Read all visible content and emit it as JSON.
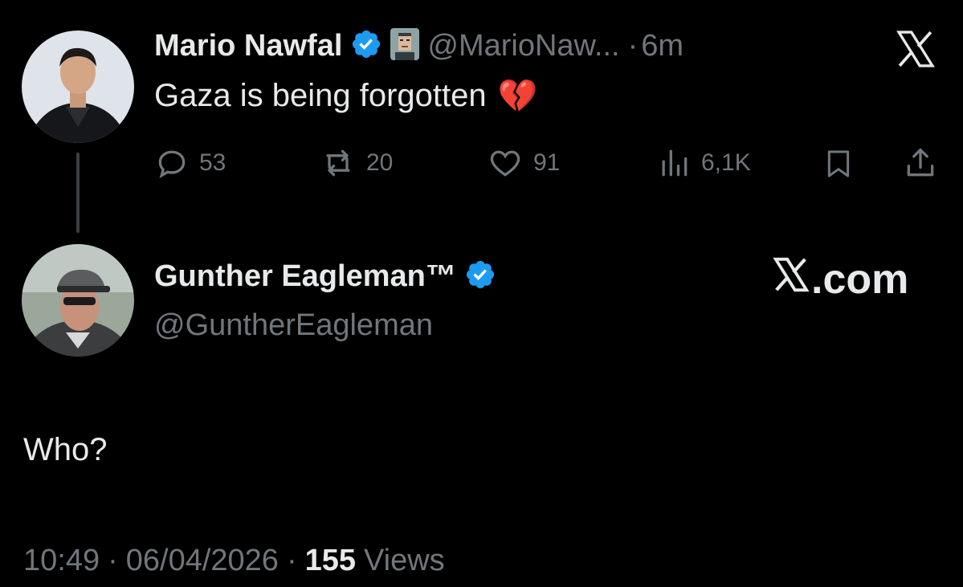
{
  "quoted_tweet": {
    "author_name": "Mario Nawfal",
    "handle": "@MarioNaw...",
    "separator": "·",
    "time": "6m",
    "text": "Gaza is being forgotten",
    "emoji": "💔",
    "stats": {
      "replies": "53",
      "reposts": "20",
      "likes": "91",
      "views": "6,1K"
    }
  },
  "reply_tweet": {
    "author_name": "Gunther Eagleman™",
    "handle": "@GuntherEagleman",
    "text": "Who?",
    "time": "10:49",
    "date": "06/04/2026",
    "separator": "·",
    "views_count": "155",
    "views_label": "Views"
  },
  "watermark": {
    "text": ".com"
  },
  "colors": {
    "background": "#000000",
    "text": "#e7e9ea",
    "muted": "#71767b",
    "verified": "#1d9bf0",
    "heart_emoji": "#e0245e"
  },
  "icons": [
    "verified-badge-icon",
    "pixel-avatar-badge-icon",
    "x-logo-icon",
    "reply-icon",
    "repost-icon",
    "like-icon",
    "views-icon",
    "bookmark-icon",
    "share-icon"
  ]
}
